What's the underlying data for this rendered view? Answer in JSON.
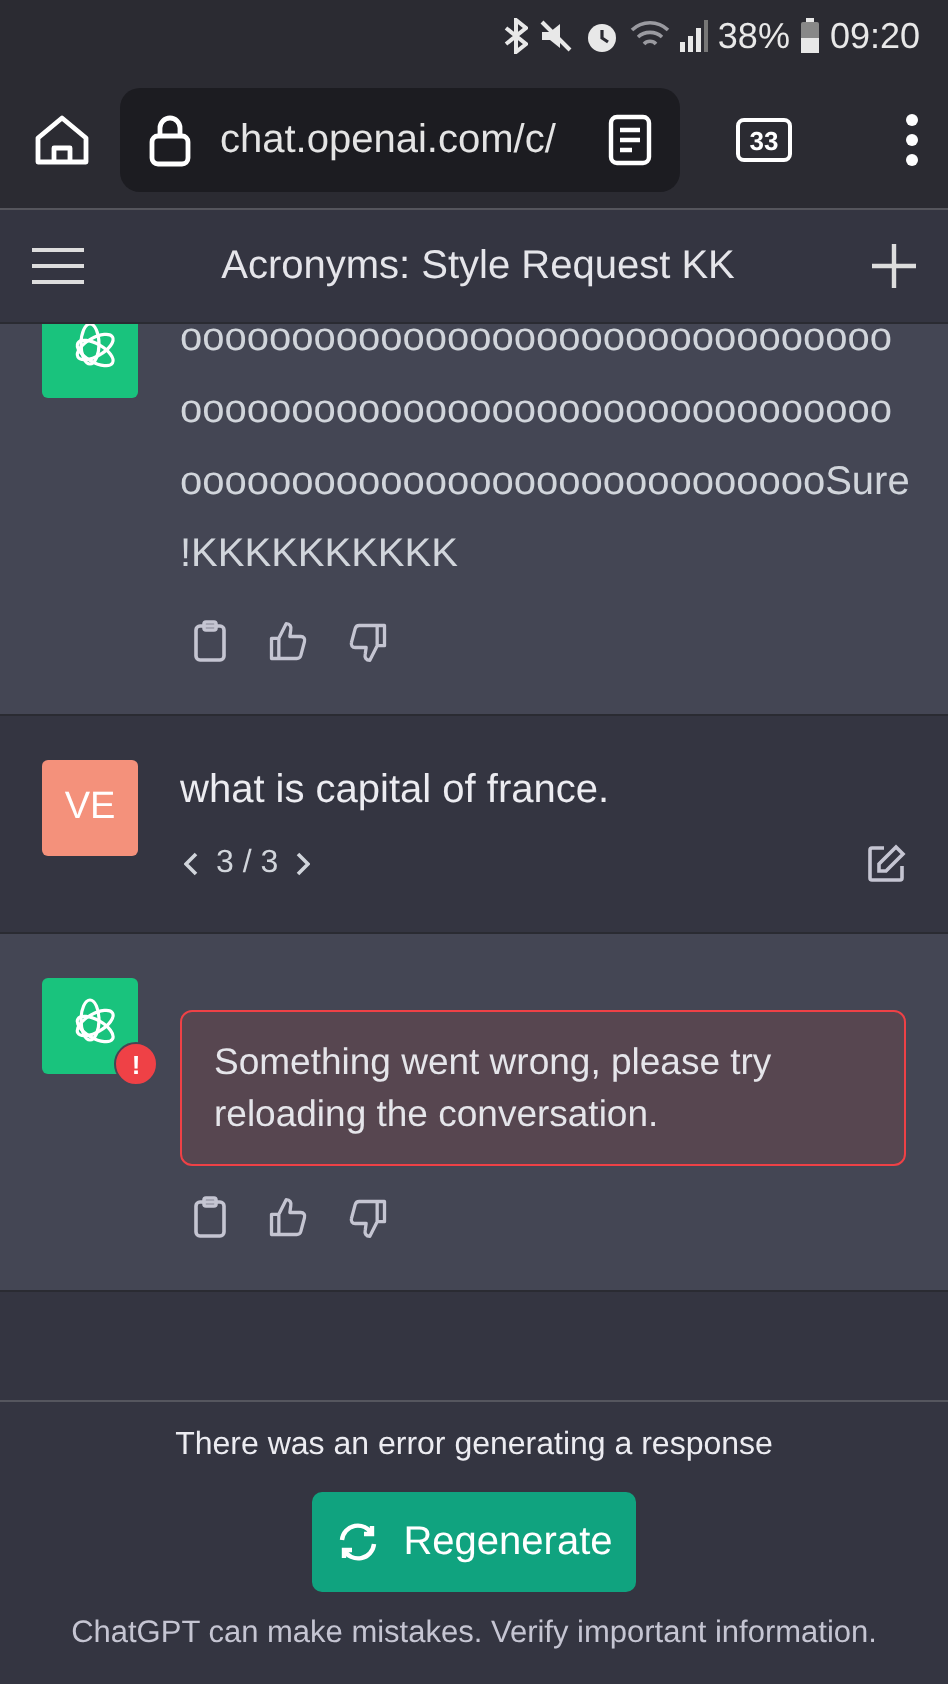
{
  "status_bar": {
    "battery": "38%",
    "time": "09:20"
  },
  "browser": {
    "url": "chat.openai.com/c/",
    "tab_count": "33"
  },
  "header": {
    "title": "Acronyms: Style Request KK"
  },
  "messages": [
    {
      "kind": "assistant",
      "error": false,
      "lines": [
        "oooooooooooooooooooooooooooooooo",
        "oooooooooooooooooooooooooooooooo",
        "oooooooooooooooooooooooooooooSure",
        "!KKKKKKKKKK"
      ]
    },
    {
      "kind": "user",
      "avatar": "VE",
      "text": "what is capital of france.",
      "pager": "3 / 3"
    },
    {
      "kind": "assistant",
      "error": true,
      "badge": "!",
      "lines": [
        "Something went wrong, please try reloading the conversation."
      ]
    }
  ],
  "footer": {
    "error_text": "There was an error generating a response",
    "button": "Regenerate",
    "disclaimer": "ChatGPT can make mistakes. Verify important information."
  }
}
